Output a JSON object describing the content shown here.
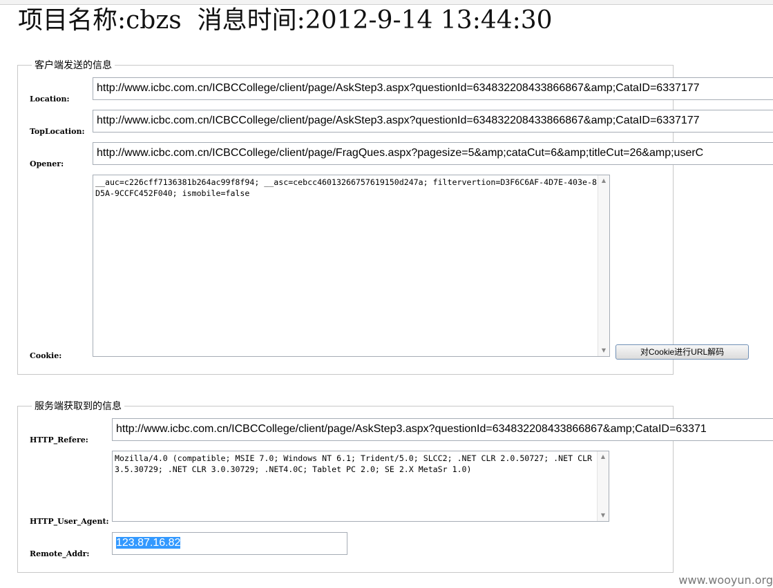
{
  "header": {
    "project_label": "项目名称:cbzs",
    "time_label": "消息时间:2012-9-14 13:44:30"
  },
  "client_section": {
    "legend": "客户端发送的信息",
    "location_label": "Location:",
    "location_value": "http://www.icbc.com.cn/ICBCCollege/client/page/AskStep3.aspx?questionId=634832208433866867&amp;CataID=6337177",
    "toplocation_label": "TopLocation:",
    "toplocation_value": "http://www.icbc.com.cn/ICBCCollege/client/page/AskStep3.aspx?questionId=634832208433866867&amp;CataID=6337177",
    "opener_label": "Opener:",
    "opener_value": "http://www.icbc.com.cn/ICBCCollege/client/page/FragQues.aspx?pagesize=5&amp;cataCut=6&amp;titleCut=26&amp;userC",
    "cookie_label": "Cookie:",
    "cookie_value": "__auc=c226cff7136381b264ac99f8f94; __asc=cebcc46013266757619150d247a; filtervertion=D3F6C6AF-4D7E-403e-8D5A-9CCFC452F040; ismobile=false",
    "decode_button": "对Cookie进行URL解码"
  },
  "server_section": {
    "legend": "服务端获取到的信息",
    "referer_label": "HTTP_Refere:",
    "referer_value": "http://www.icbc.com.cn/ICBCCollege/client/page/AskStep3.aspx?questionId=634832208433866867&amp;CataID=63371",
    "ua_label": "HTTP_User_Agent:",
    "ua_value": "Mozilla/4.0 (compatible; MSIE 7.0; Windows NT 6.1; Trident/5.0; SLCC2; .NET CLR 2.0.50727; .NET CLR 3.5.30729; .NET CLR 3.0.30729; .NET4.0C; Tablet PC 2.0; SE 2.X MetaSr 1.0)",
    "remote_label": "Remote_Addr:",
    "remote_value": "123.87.16.82"
  },
  "watermark": "www.wooyun.org"
}
